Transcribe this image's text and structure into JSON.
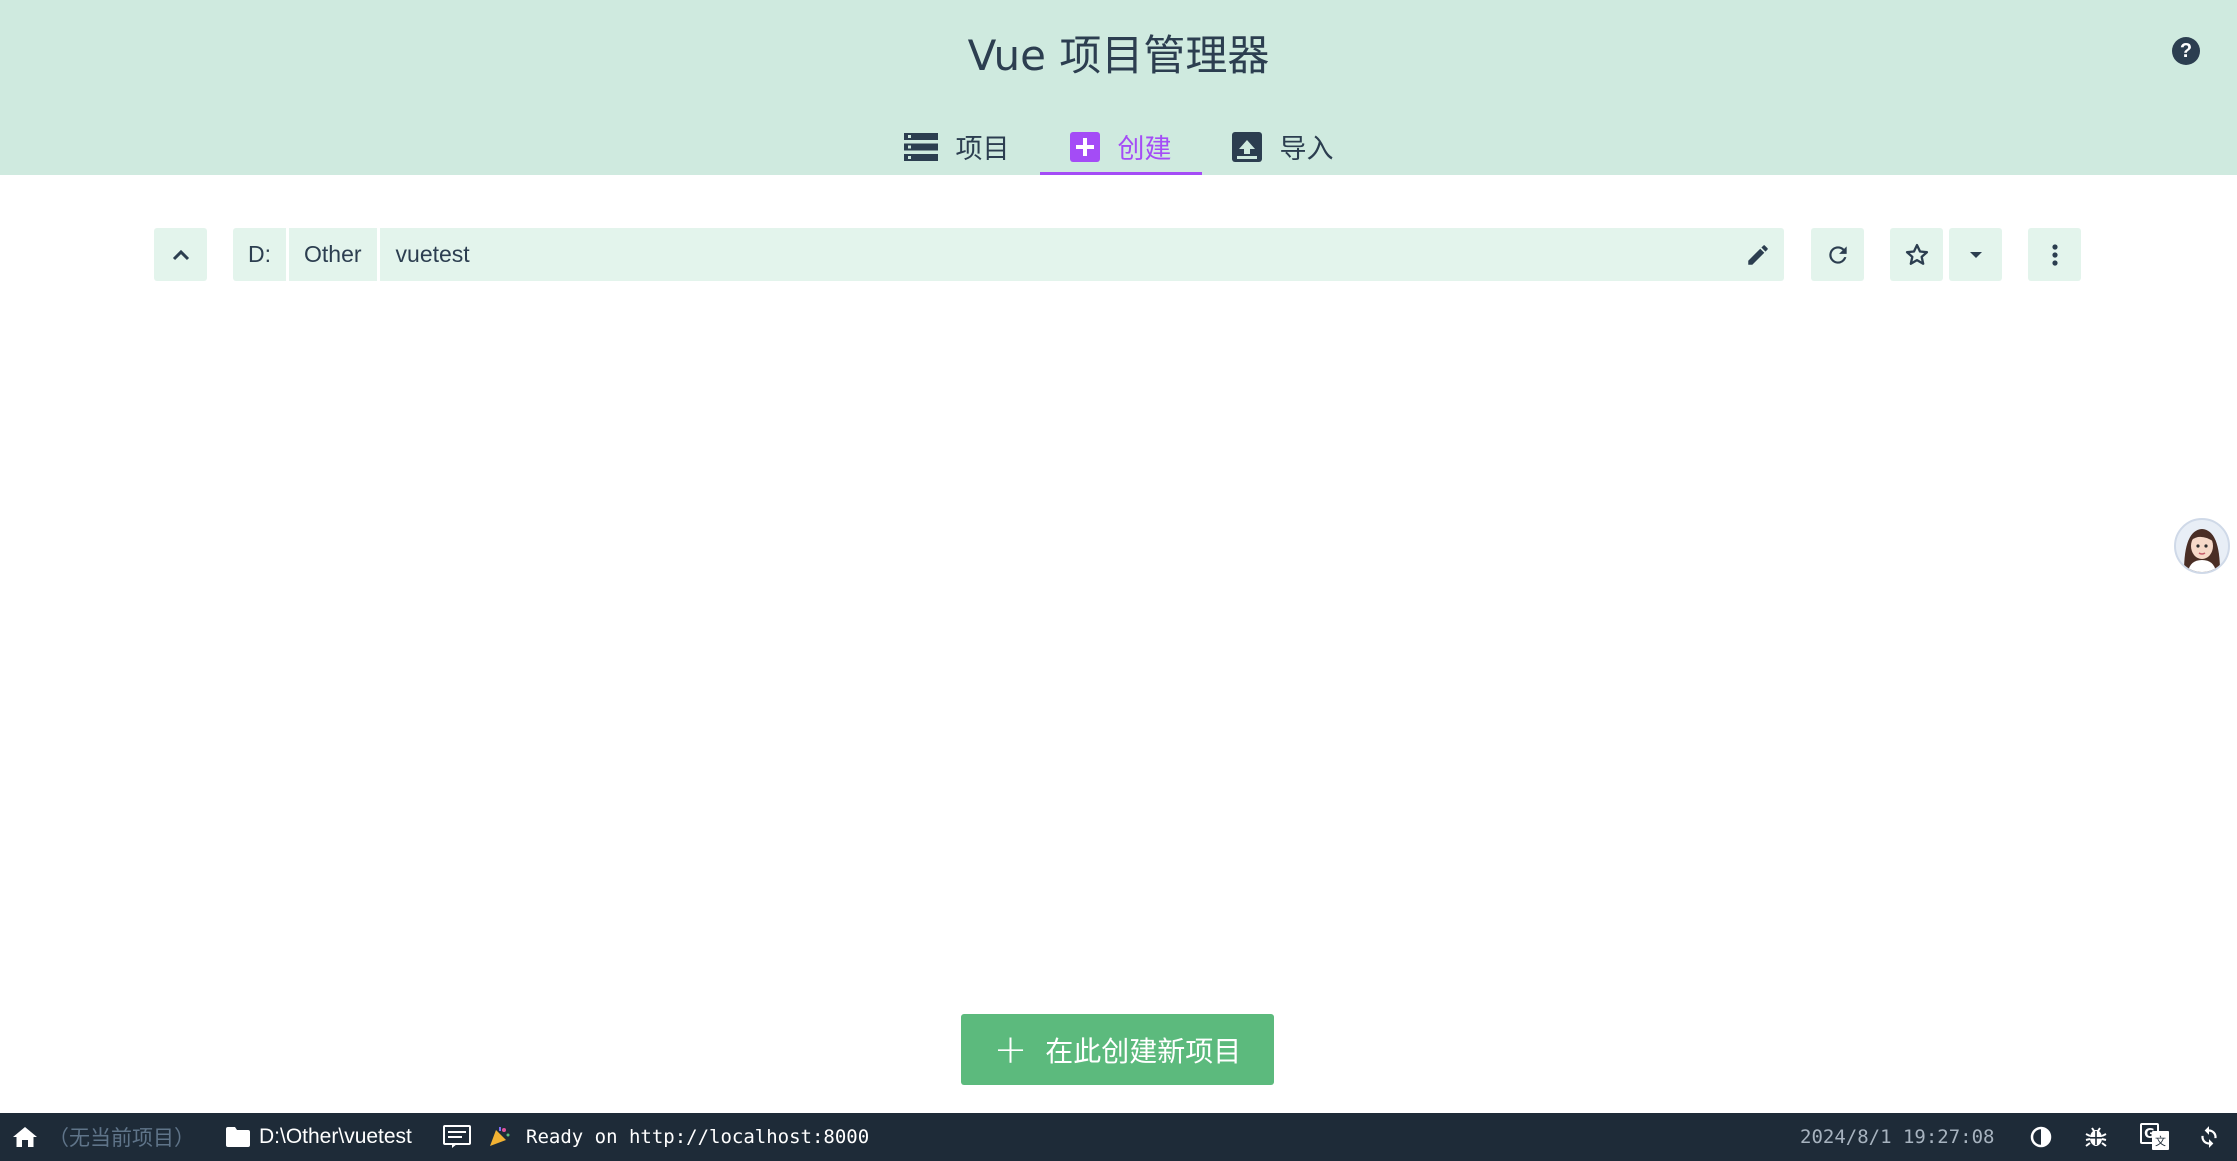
{
  "header": {
    "title": "Vue 项目管理器",
    "help_icon": "question-circle-icon",
    "tabs": [
      {
        "label": "项目",
        "icon": "list-icon",
        "active": false
      },
      {
        "label": "创建",
        "icon": "plus-square-icon",
        "active": true
      },
      {
        "label": "导入",
        "icon": "import-icon",
        "active": false
      }
    ],
    "accent_color": "#a44cf6",
    "background_color": "#cfeadf"
  },
  "toolbar": {
    "up_icon": "chevron-up-icon",
    "path_segments": [
      "D:",
      "Other",
      "vuetest"
    ],
    "edit_icon": "pencil-icon",
    "refresh_icon": "refresh-icon",
    "favorite_icon": "star-outline-icon",
    "favorites_dropdown_icon": "caret-down-icon",
    "more_icon": "more-vert-icon"
  },
  "main": {
    "create_button_label": "在此创建新项目",
    "create_button_color": "#5cba7d"
  },
  "statusbar": {
    "home_icon": "home-icon",
    "current_project": "（无当前项目）",
    "folder_icon": "folder-icon",
    "cwd": "D:\\Other\\vuetest",
    "log_icon": "terminal-log-icon",
    "status_icon": "celebration-icon",
    "status_message": "Ready on http://localhost:8000",
    "timestamp": "2024/8/1 19:27:08",
    "theme_icon": "dark-mode-icon",
    "bug_icon": "bug-icon",
    "translate_icon": "translate-icon",
    "refresh_icon": "refresh-icon"
  }
}
